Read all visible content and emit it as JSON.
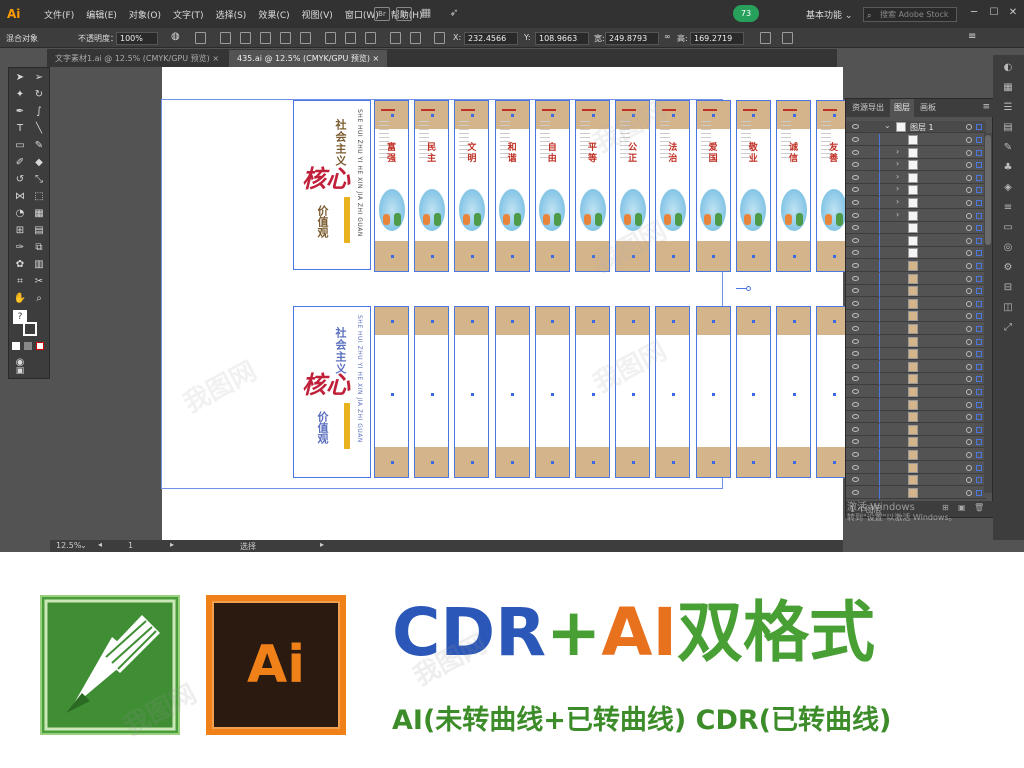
{
  "menubar": {
    "logo": "Ai",
    "menus": [
      "文件(F)",
      "编辑(E)",
      "对象(O)",
      "文字(T)",
      "选择(S)",
      "效果(C)",
      "视图(V)",
      "窗口(W)",
      "帮助(H)"
    ],
    "sync_badge": "73",
    "workspace": "基本功能",
    "search_placeholder": "搜索 Adobe Stock",
    "br_icon": "Br",
    "st_icon": "St"
  },
  "control_bar": {
    "object_label": "混合对象",
    "opacity_label": "不透明度：",
    "opacity_value": "100%",
    "x_label": "X:",
    "x_value": "232.4566",
    "y_label": "Y:",
    "y_value": "108.9663",
    "w_label": "宽:",
    "w_value": "249.8793",
    "h_label": "高:",
    "h_value": "169.2719"
  },
  "tabs": [
    {
      "label": "文字素材1.ai @ 12.5% (CMYK/GPU 预览)",
      "close": "×",
      "active": false
    },
    {
      "label": "435.ai @ 12.5% (CMYK/GPU 预览)",
      "close": "×",
      "active": true
    }
  ],
  "artboard": {
    "side_top": {
      "line1": "社会主义",
      "line2": "核心",
      "line3": "价值观",
      "pinyin": "SHE HUI ZHU YI HE XIN JIA ZHI GUAN"
    },
    "side_bottom": {
      "line1": "社会主义",
      "line2": "核心",
      "line3": "价值观",
      "pinyin": "SHE HUI ZHU YI HE XIN JIA ZHI GUAN"
    },
    "panels": [
      "富强",
      "民主",
      "文明",
      "和谐",
      "自由",
      "平等",
      "公正",
      "法治",
      "爱国",
      "敬业",
      "诚信",
      "友善"
    ]
  },
  "layers_panel": {
    "tabs": [
      "资源导出",
      "图层",
      "画板"
    ],
    "active_tab": "图层",
    "layer_name": "图层 1",
    "footer": "1 个图层",
    "row_count": 29
  },
  "status": {
    "zoom": "12.5%",
    "page": "1",
    "tool": "选择"
  },
  "activate_windows": {
    "line1": "激活 Windows",
    "line2": "转到\"设置\"以激活 Windows。"
  },
  "promo": {
    "title_cdr": "CDR",
    "title_plus": "+",
    "title_ai": "AI",
    "title_rest": "双格式",
    "subtitle": "AI(未转曲线+已转曲线) CDR(已转曲线)",
    "ai_logo_text": "Ai",
    "colors": {
      "blue": "#2b58b8",
      "orange": "#e8711e",
      "green": "#48a034"
    }
  },
  "watermark": "我图网"
}
